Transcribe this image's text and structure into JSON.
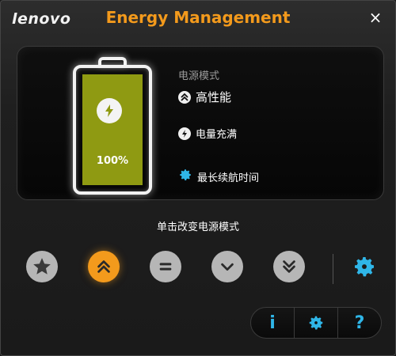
{
  "app": {
    "logo": "lenovo",
    "title": "Energy Management",
    "close_label": "×"
  },
  "status": {
    "mode_caption": "电源模式",
    "mode_name": "高性能",
    "charge_status": "电量充满",
    "longest_battery_label": "最长续航时间"
  },
  "battery": {
    "percent_label": "100%",
    "level": 1.0,
    "fill_color": "#8f9a12"
  },
  "mode_selector": {
    "caption": "单击改变电源模式",
    "buttons": [
      {
        "icon": "star-icon",
        "active": false
      },
      {
        "icon": "double-chevron-up-icon",
        "active": true
      },
      {
        "icon": "equals-icon",
        "active": false
      },
      {
        "icon": "chevron-down-icon",
        "active": false
      },
      {
        "icon": "double-chevron-down-icon",
        "active": false
      }
    ],
    "settings_icon": "gear-icon"
  },
  "bottom_bar": {
    "info_label": "i",
    "settings_icon": "gear-icon",
    "help_label": "?"
  },
  "colors": {
    "accent": "#f39a1c",
    "blue": "#2fb6e8",
    "button_gray": "#b6b6b6"
  }
}
